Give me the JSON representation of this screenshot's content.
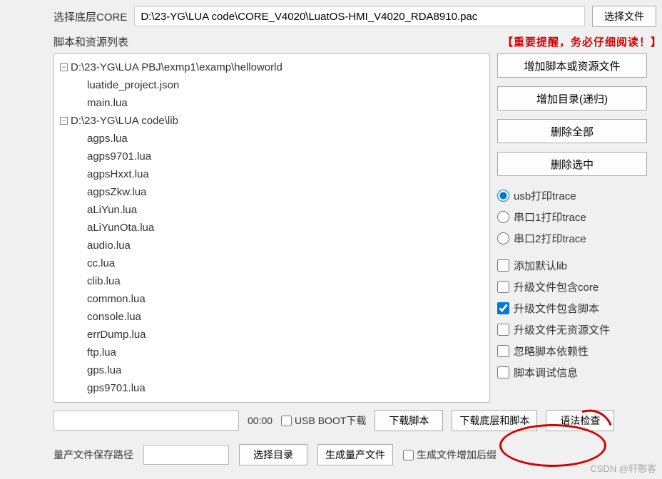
{
  "top": {
    "core_label": "选择底层CORE",
    "core_path": "D:\\23-YG\\LUA code\\CORE_V4020\\LuatOS-HMI_V4020_RDA8910.pac",
    "choose_file": "选择文件"
  },
  "mid": {
    "list_label": "脚本和资源列表",
    "warn": "【重要提醒，务必仔细阅读！】"
  },
  "tree": {
    "root1": "D:\\23-YG\\LUA PBJ\\exmp1\\examp\\helloworld",
    "root1_files": [
      "luatide_project.json",
      "main.lua"
    ],
    "root2": "D:\\23-YG\\LUA code\\lib",
    "root2_files": [
      "agps.lua",
      "agps9701.lua",
      "agpsHxxt.lua",
      "agpsZkw.lua",
      "aLiYun.lua",
      "aLiYunOta.lua",
      "audio.lua",
      "cc.lua",
      "clib.lua",
      "common.lua",
      "console.lua",
      "errDump.lua",
      "ftp.lua",
      "gps.lua",
      "gps9701.lua"
    ]
  },
  "side": {
    "btn_add_script": "增加脚本或资源文件",
    "btn_add_dir": "增加目录(递归)",
    "btn_del_all": "删除全部",
    "btn_del_sel": "删除选中",
    "radios": [
      "usb打印trace",
      "串口1打印trace",
      "串口2打印trace"
    ],
    "checks": {
      "add_lib": "添加默认lib",
      "inc_core": "升级文件包含core",
      "inc_script": "升级文件包含脚本",
      "no_res": "升级文件无资源文件",
      "ignore_dep": "忽略脚本依赖性",
      "debug_info": "脚本调试信息"
    }
  },
  "bottom": {
    "time": "00:00",
    "usb_boot": "USB BOOT下载",
    "btn_dl_script": "下载脚本",
    "btn_dl_core_script": "下载底层和脚本",
    "btn_syntax": "语法检查"
  },
  "bottom2": {
    "label_path": "量产文件保存路径",
    "btn_sel_dir": "选择目录",
    "btn_gen": "生成量产文件",
    "cb_enc": "生成文件增加后缀"
  },
  "watermark": "CSDN @轩憨客"
}
